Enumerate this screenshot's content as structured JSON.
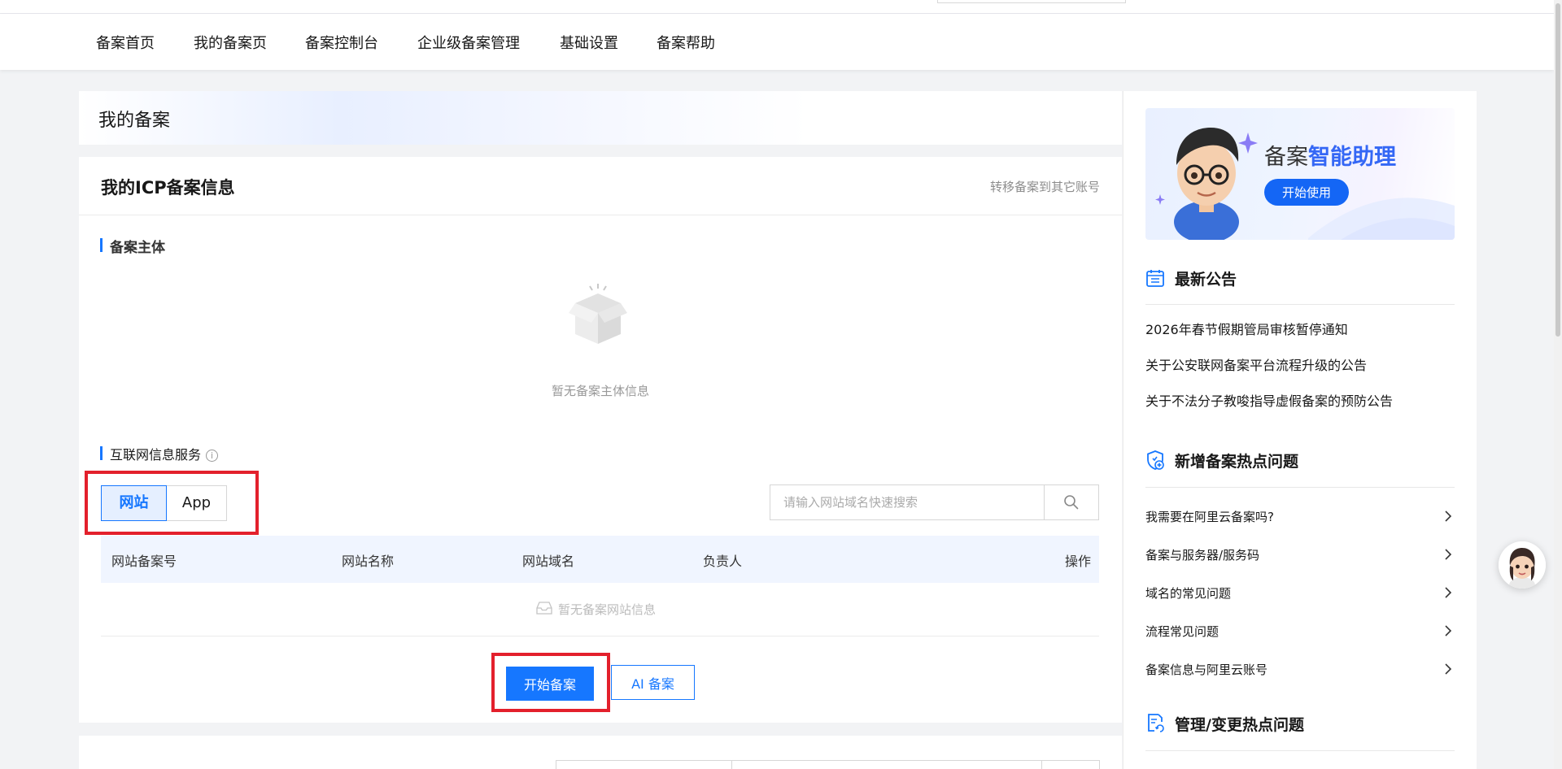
{
  "nav": {
    "items": [
      "备案首页",
      "我的备案页",
      "备案控制台",
      "企业级备案管理",
      "基础设置",
      "备案帮助"
    ]
  },
  "page": {
    "title": "我的备案"
  },
  "icp_card": {
    "title": "我的ICP备案信息",
    "transfer_link": "转移备案到其它账号",
    "subject_section": "备案主体",
    "subject_empty": "暂无备案主体信息",
    "internet_section": "互联网信息服务",
    "tabs": [
      "网站",
      "App"
    ],
    "active_tab": "网站",
    "search_placeholder": "请输入网站域名快速搜索",
    "table_headers": [
      "网站备案号",
      "网站名称",
      "网站域名",
      "负责人",
      "操作"
    ],
    "table_empty": "暂无备案网站信息",
    "start_button": "开始备案",
    "ai_button": "AI 备案"
  },
  "sidebar": {
    "banner": {
      "title_plain": "备案",
      "title_highlight": "智能助理",
      "button": "开始使用"
    },
    "announcements": {
      "title": "最新公告",
      "items": [
        "2026年春节假期管局审核暂停通知",
        "关于公安联网备案平台流程升级的公告",
        "关于不法分子教唆指导虚假备案的预防公告"
      ]
    },
    "hot_new": {
      "title": "新增备案热点问题",
      "items": [
        "我需要在阿里云备案吗?",
        "备案与服务器/服务码",
        "域名的常见问题",
        "流程常见问题",
        "备案信息与阿里云账号"
      ]
    },
    "hot_change": {
      "title": "管理/变更热点问题"
    }
  },
  "colors": {
    "accent": "#1677ff",
    "highlight_box": "#e3202c",
    "page_bg": "#f2f3f5"
  }
}
